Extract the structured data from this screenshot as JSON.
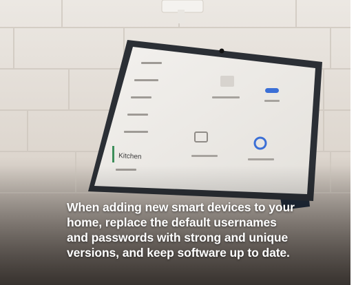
{
  "caption": {
    "lines": [
      "When adding new smart devices to your",
      "home, replace the default usernames",
      "and passwords with strong and unique",
      "versions, and keep software up to date."
    ]
  },
  "device_screen": {
    "menu_items": [
      "Kitchen"
    ]
  },
  "colors": {
    "caption_text": "#ffffff",
    "wall": "#e6e1da",
    "device_frame": "#2b2f35",
    "device_stand": "#1f2a3a",
    "screen_bg": "#efede9",
    "accent_blue": "#3b6fd6"
  }
}
